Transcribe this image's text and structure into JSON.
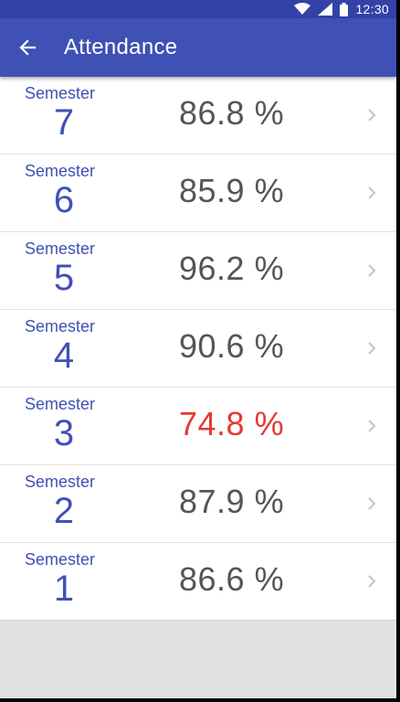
{
  "status_bar": {
    "time": "12:30"
  },
  "app_bar": {
    "title": "Attendance"
  },
  "colors": {
    "primary": "#3f51b5",
    "primary_dark": "#3342a6",
    "warning": "#e53935",
    "text": "#555555"
  },
  "rows": [
    {
      "label": "Semester",
      "number": "7",
      "percent": "86.8 %"
    },
    {
      "label": "Semester",
      "number": "6",
      "percent": "85.9 %"
    },
    {
      "label": "Semester",
      "number": "5",
      "percent": "96.2 %"
    },
    {
      "label": "Semester",
      "number": "4",
      "percent": "90.6 %"
    },
    {
      "label": "Semester",
      "number": "3",
      "percent": "74.8 %"
    },
    {
      "label": "Semester",
      "number": "2",
      "percent": "87.9 %"
    },
    {
      "label": "Semester",
      "number": "1",
      "percent": "86.6 %"
    }
  ]
}
